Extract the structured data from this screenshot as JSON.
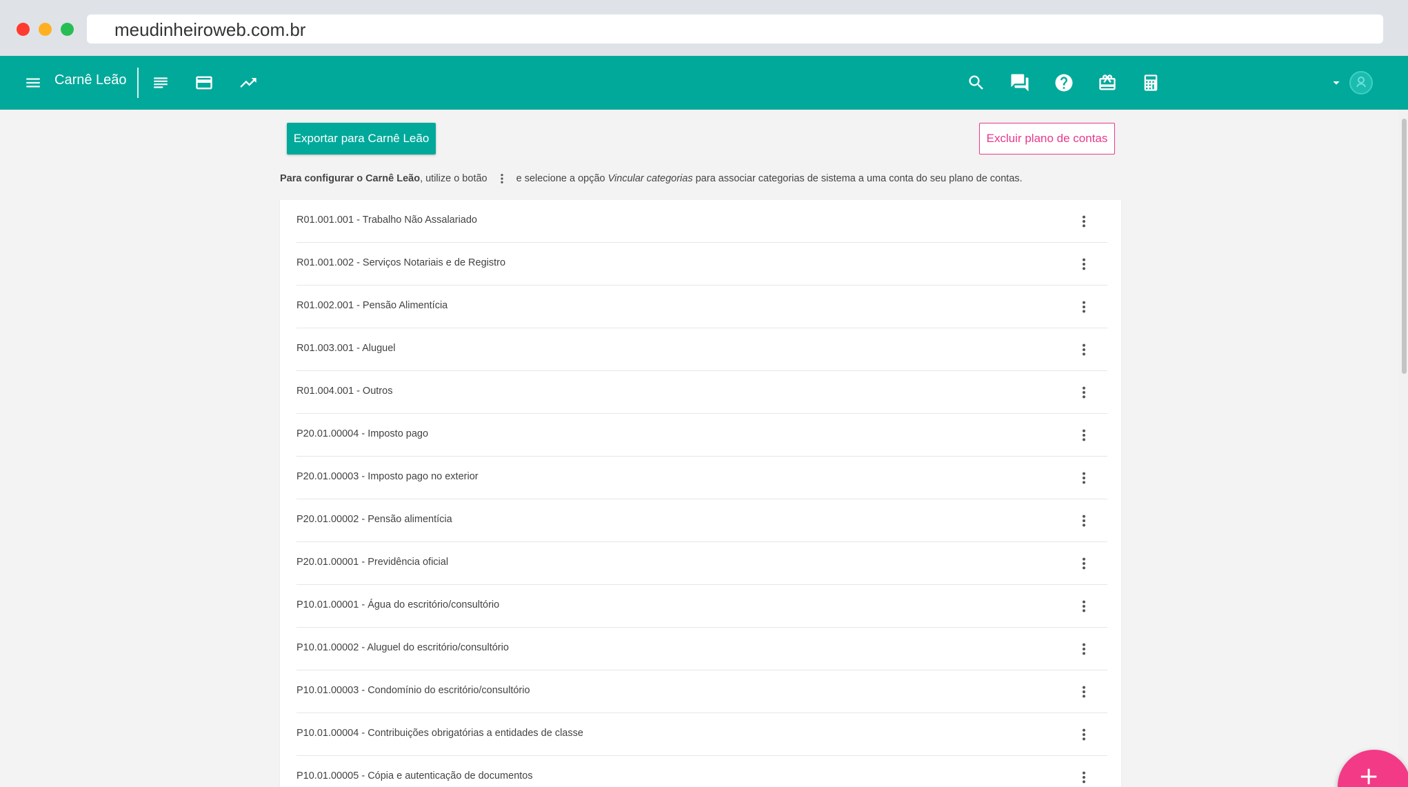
{
  "browser": {
    "url": "meudinheiroweb.com.br"
  },
  "appbar": {
    "title": "Carnê Leão",
    "icons": {
      "menu": "menu-icon",
      "list": "list-icon",
      "card": "credit-card-icon",
      "trend": "trending-up-icon",
      "search": "search-icon",
      "chat": "chat-icon",
      "help": "help-icon",
      "gift": "gift-card-icon",
      "calculator": "calculator-icon",
      "dropdown": "caret-down-icon"
    },
    "accent": "#00a99a"
  },
  "toolbar": {
    "export_label": "Exportar para Carnê Leão",
    "delete_label": "Excluir plano de contas"
  },
  "info": {
    "bold": "Para configurar o Carnê Leão",
    "part1": ", utilize o botão",
    "part2": "e selecione a opção",
    "italic": "Vincular categorias",
    "part3": "para associar categorias de sistema a uma conta do seu plano de contas."
  },
  "accounts": [
    {
      "label": "R01.001.001 - Trabalho Não Assalariado"
    },
    {
      "label": "R01.001.002 - Serviços Notariais e de Registro"
    },
    {
      "label": "R01.002.001 - Pensão Alimentícia"
    },
    {
      "label": "R01.003.001 - Aluguel"
    },
    {
      "label": "R01.004.001 - Outros"
    },
    {
      "label": "P20.01.00004 - Imposto pago"
    },
    {
      "label": "P20.01.00003 - Imposto pago no exterior"
    },
    {
      "label": "P20.01.00002 - Pensão alimentícia"
    },
    {
      "label": "P20.01.00001 - Previdência oficial"
    },
    {
      "label": "P10.01.00001 - Água do escritório/consultório"
    },
    {
      "label": "P10.01.00002 - Aluguel do escritório/consultório"
    },
    {
      "label": "P10.01.00003 - Condomínio do escritório/consultório"
    },
    {
      "label": "P10.01.00004 - Contribuições obrigatórias a entidades de classe"
    },
    {
      "label": "P10.01.00005 - Cópia e autenticação de documentos"
    }
  ],
  "fab": {
    "label": "+",
    "color": "#f23a86"
  }
}
